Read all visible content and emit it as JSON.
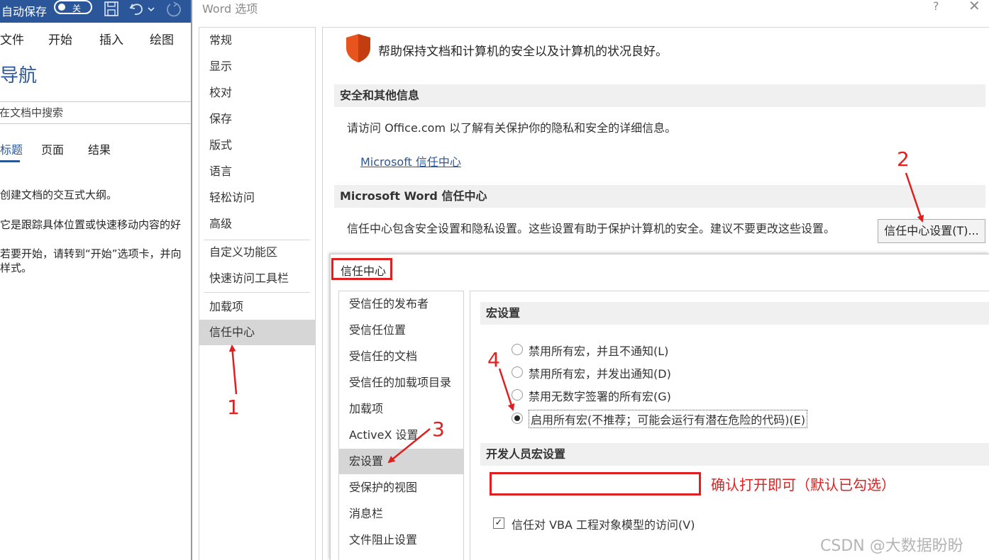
{
  "word": {
    "autosave_label": "自动保存",
    "autosave_toggle": "关",
    "ribbon_tabs": [
      "文件",
      "开始",
      "插入",
      "绘图"
    ],
    "nav_title": "导航",
    "search_placeholder": "在文档中搜索",
    "nav_tabs": [
      "标题",
      "页面",
      "结果"
    ],
    "nav_paragraphs": [
      "创建文档的交互式大纲。",
      "它是跟踪具体位置或快速移动内容的好",
      "若要开始，请转到“开始”选项卡，并向",
      "样式。"
    ]
  },
  "dialog": {
    "title": "Word 选项",
    "help": "?",
    "close": "✕",
    "nav_items": [
      "常规",
      "显示",
      "校对",
      "保存",
      "版式",
      "语言",
      "轻松访问",
      "高级",
      "自定义功能区",
      "快速访问工具栏",
      "加载项",
      "信任中心"
    ],
    "selected_nav": "信任中心",
    "intro": "帮助保持文档和计算机的安全以及计算机的状况良好。",
    "section_security": "安全和其他信息",
    "visit_text": "请访问 Office.com 以了解有关保护你的隐私和安全的详细信息。",
    "ms_trust_link": "Microsoft 信任中心",
    "section_trust": "Microsoft Word 信任中心",
    "trust_desc": "信任中心包含安全设置和隐私设置。这些设置有助于保护计算机的安全。建议不要更改这些设置。",
    "trust_settings_button": "信任中心设置(T)..."
  },
  "trust_center": {
    "title": "信任中心",
    "nav_items": [
      "受信任的发布者",
      "受信任位置",
      "受信任的文档",
      "受信任的加载项目录",
      "加载项",
      "ActiveX 设置",
      "宏设置",
      "受保护的视图",
      "消息栏",
      "文件阻止设置"
    ],
    "selected_nav": "宏设置",
    "macro_section": "宏设置",
    "macro_options": [
      {
        "label": "禁用所有宏，并且不通知(L)",
        "checked": false
      },
      {
        "label": "禁用所有宏，并发出通知(D)",
        "checked": false
      },
      {
        "label": "禁用无数字签署的所有宏(G)",
        "checked": false
      },
      {
        "label": "启用所有宏(不推荐；可能会运行有潜在危险的代码)(E)",
        "checked": true
      }
    ],
    "dev_section": "开发人员宏设置",
    "vba_label": "信任对 VBA 工程对象模型的访问(V)",
    "vba_checked": true,
    "vba_check_glyph": "✓"
  },
  "annotations": {
    "numbers": [
      "1",
      "2",
      "3",
      "4"
    ],
    "note": "确认打开即可（默认已勾选）",
    "color": "#e02020"
  },
  "watermark": "CSDN @大数据盼盼",
  "colors": {
    "word_blue": "#2b579a",
    "shield": "#e8541e",
    "selected_bg": "#d6d6d6"
  }
}
